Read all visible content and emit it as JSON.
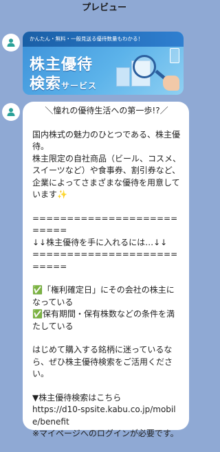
{
  "header": {
    "title": "プレビュー"
  },
  "banner": {
    "tagline": "かんたん・無料・一般見送る優待数量もわかる！",
    "title_line1": "株主優待",
    "title_line2_main": "検索",
    "title_line2_small": "サービス"
  },
  "message": {
    "heading": "＼憧れの優待生活への第一歩!?／",
    "paragraph1": "国内株式の魅力のひとつである、株主優待。\n株主限定の自社商品（ビール、コスメ、スイーツなど）や食事券、割引券など、企業によってさまざまな優待を用意しています✨",
    "divider_top": "==========================",
    "section_title": "↓↓株主優待を手に入れるには…↓↓",
    "divider_bottom": "==========================",
    "check1": "✅「権利確定日」にその会社の株主になっている",
    "check2": "✅保有期間・保有株数などの条件を満たしている",
    "paragraph2": "はじめて購入する銘柄に迷っているなら、ぜひ株主優待検索をご活用ください。",
    "link_label": "▼株主優待検索はこちら",
    "link_url": "https://d10-spsite.kabu.co.jp/mobile/benefit",
    "note": "※マイページへのログインが必要です。"
  },
  "colors": {
    "background": "#8fa9d4",
    "avatar_icon": "#2aa198",
    "bubble": "#ffffff"
  }
}
